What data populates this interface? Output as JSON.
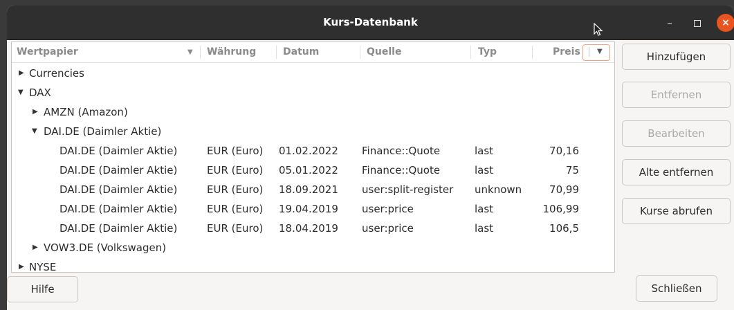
{
  "window": {
    "title": "Kurs-Datenbank",
    "min_glyph": "–",
    "close_glyph": "×"
  },
  "columns": {
    "wertpapier": "Wertpapier",
    "waehrung": "Währung",
    "datum": "Datum",
    "quelle": "Quelle",
    "typ": "Typ",
    "preis": "Preis"
  },
  "tree": {
    "currencies": "Currencies",
    "dax": "DAX",
    "amzn": "AMZN (Amazon)",
    "dai": "DAI.DE (Daimler Aktie)",
    "vow3": "VOW3.DE (Volkswagen)",
    "nyse": "NYSE",
    "prices": [
      {
        "sec": "DAI.DE (Daimler Aktie)",
        "cur": "EUR (Euro)",
        "date": "01.02.2022",
        "src": "Finance::Quote",
        "type": "last",
        "price": "70,16"
      },
      {
        "sec": "DAI.DE (Daimler Aktie)",
        "cur": "EUR (Euro)",
        "date": "05.01.2022",
        "src": "Finance::Quote",
        "type": "last",
        "price": "75"
      },
      {
        "sec": "DAI.DE (Daimler Aktie)",
        "cur": "EUR (Euro)",
        "date": "18.09.2021",
        "src": "user:split-register",
        "type": "unknown",
        "price": "70,99"
      },
      {
        "sec": "DAI.DE (Daimler Aktie)",
        "cur": "EUR (Euro)",
        "date": "19.04.2019",
        "src": "user:price",
        "type": "last",
        "price": "106,99"
      },
      {
        "sec": "DAI.DE (Daimler Aktie)",
        "cur": "EUR (Euro)",
        "date": "18.04.2019",
        "src": "user:price",
        "type": "last",
        "price": "106,5"
      }
    ]
  },
  "buttons": {
    "add": "Hinzufügen",
    "remove": "Entfernen",
    "edit": "Bearbeiten",
    "remove_old": "Alte entfernen",
    "fetch": "Kurse abrufen",
    "help": "Hilfe",
    "close": "Schließen"
  }
}
